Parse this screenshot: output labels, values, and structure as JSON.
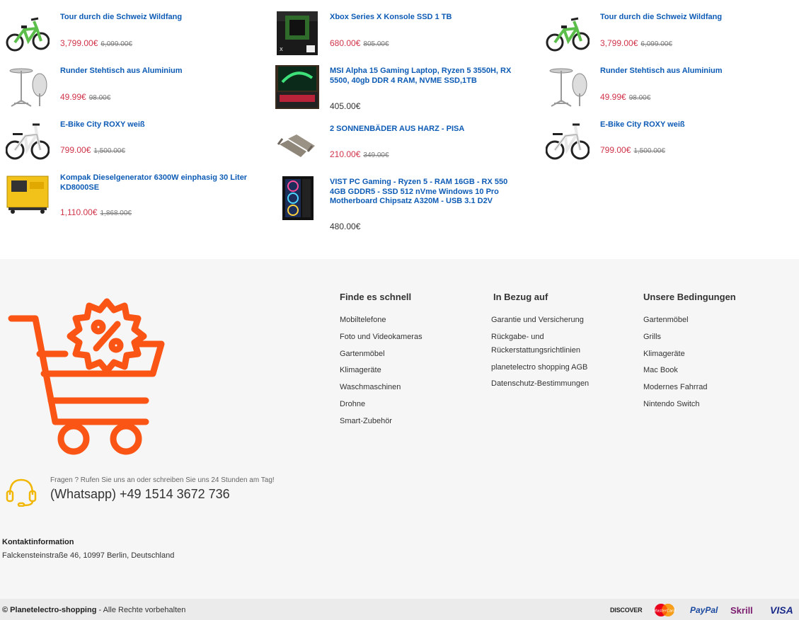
{
  "products": {
    "col0": [
      {
        "title": "Tour durch die Schweiz Wildfang",
        "price": "3,799.00€",
        "old_price": "6,099.00€",
        "image": "green-ebike"
      },
      {
        "title": "Runder Stehtisch aus Aluminium",
        "price": "49.99€",
        "old_price": "98.00€",
        "image": "bistro-table"
      },
      {
        "title": "E-Bike City ROXY weiß",
        "price": "799.00€",
        "old_price": "1,500.00€",
        "image": "white-ebike"
      },
      {
        "title": "Kompak Dieselgenerator 6300W einphasig 30 Liter KD8000SE",
        "price": "1,110.00€",
        "old_price": "1,868.00€",
        "image": "yellow-generator"
      }
    ],
    "col1": [
      {
        "title": "Xbox Series X Konsole SSD 1 TB",
        "price": "680.00€",
        "old_price": "805.00€",
        "image": "xbox-box"
      },
      {
        "title": "MSI Alpha 15 Gaming Laptop, Ryzen 5 3550H, RX 5500, 40gb DDR 4 RAM, NVME SSD,1TB",
        "price": "405.00€",
        "old_price": "",
        "image": "gaming-laptop"
      },
      {
        "title": "2 SONNENBÄDER AUS HARZ - PISA",
        "price": "210.00€",
        "old_price": "349.00€",
        "image": "sun-loungers"
      },
      {
        "title": "VIST PC Gaming - Ryzen 5 - RAM 16GB - RX 550 4GB GDDR5 - SSD 512 nVme Windows 10 Pro Motherboard Chipsatz A320M - USB 3.1 D2V",
        "price": "480.00€",
        "old_price": "",
        "image": "gaming-pc"
      }
    ],
    "col2": [
      {
        "title": "Tour durch die Schweiz Wildfang",
        "price": "3,799.00€",
        "old_price": "6,099.00€",
        "image": "green-ebike"
      },
      {
        "title": "Runder Stehtisch aus Aluminium",
        "price": "49.99€",
        "old_price": "98.00€",
        "image": "bistro-table"
      },
      {
        "title": "E-Bike City ROXY weiß",
        "price": "799.00€",
        "old_price": "1,500.00€",
        "image": "white-ebike"
      }
    ]
  },
  "footer": {
    "logo_icon": "shopping-cart-percent-icon",
    "brand_color": "#fa5514",
    "columns": [
      {
        "heading": "Finde es schnell",
        "links": [
          "Mobiltelefone",
          "Foto und Videokameras",
          "Gartenmöbel",
          "Klimageräte",
          "Waschmaschinen",
          "Drohne",
          "Smart-Zubehör"
        ]
      },
      {
        "heading": "In Bezug auf",
        "links": [
          "Garantie und Versicherung",
          "Rückgabe- und",
          "Rückerstattungsrichtlinien",
          "planetelectro shopping AGB",
          "Datenschutz-Bestimmungen"
        ]
      },
      {
        "heading": "Unsere Bedingungen",
        "links": [
          "Gartenmöbel",
          "Grills",
          "Klimageräte",
          "Mac Book",
          "Modernes Fahrrad",
          "Nintendo Switch"
        ]
      }
    ],
    "support": {
      "icon": "headset-icon",
      "small_text": "Fragen ? Rufen Sie uns an oder schreiben Sie uns 24 Stunden am Tag!",
      "phone": "(Whatsapp) +49 1514 3672 736"
    },
    "contact": {
      "heading": "Kontaktinformation",
      "address": "Falckensteinstraße 46, 10997 Berlin, Deutschland"
    },
    "copyright": {
      "symbol": "©",
      "brand": "Planetelectro-shopping",
      "rest": "- Alle Rechte vorbehalten"
    },
    "payments": [
      "DISCOVER",
      "MasterCard",
      "PayPal",
      "Skrill",
      "VISA"
    ]
  }
}
